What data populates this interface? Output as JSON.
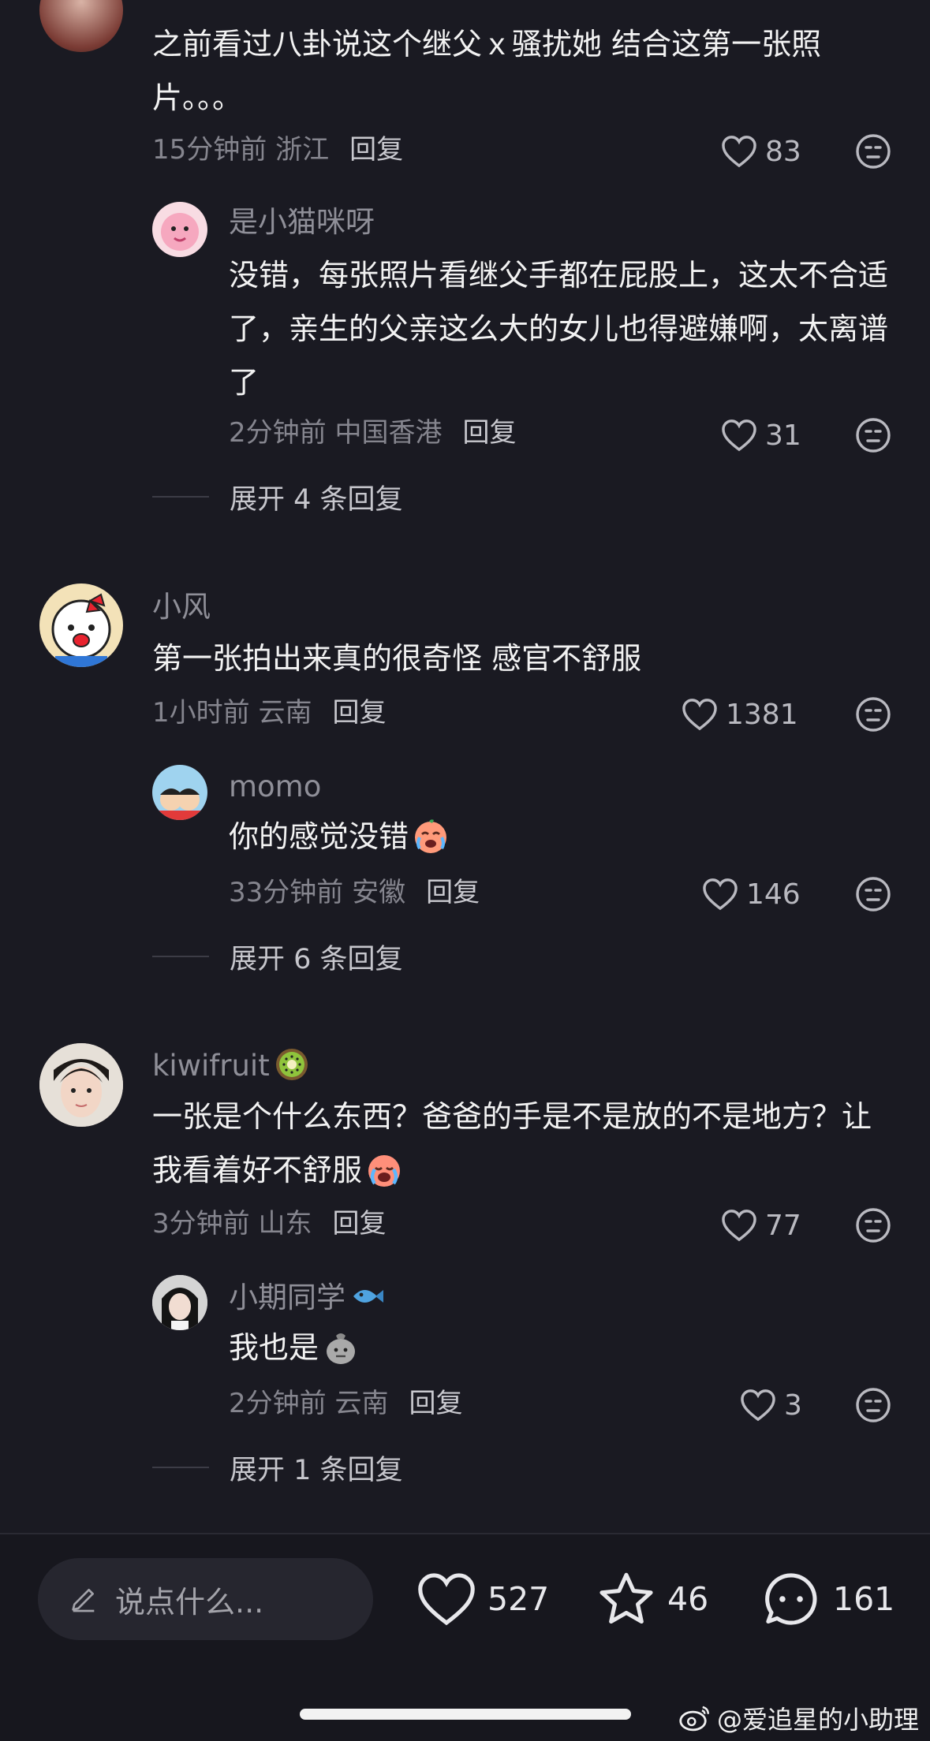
{
  "comments": [
    {
      "text": "之前看过八卦说这个继父ｘ骚扰她 结合这第一张照片。。。",
      "meta": "15分钟前 浙江",
      "reply_label": "回复",
      "likes": "83"
    },
    {
      "name": "是小猫咪呀",
      "text": "没错，每张照片看继父手都在屁股上，这太不合适了，亲生的父亲这么大的女儿也得避嫌啊，太离谱了",
      "meta": "2分钟前 中国香港",
      "reply_label": "回复",
      "likes": "31",
      "expand": "展开 4 条回复"
    },
    {
      "name": "小风",
      "text": "第一张拍出来真的很奇怪 感官不舒服",
      "meta": "1小时前 云南",
      "reply_label": "回复",
      "likes": "1381"
    },
    {
      "name": "momo",
      "text": "你的感觉没错",
      "meta": "33分钟前 安徽",
      "reply_label": "回复",
      "likes": "146",
      "expand": "展开 6 条回复"
    },
    {
      "name": "kiwifruit",
      "text": "一张是个什么东西？爸爸的手是不是放的不是地方？让我看着好不舒服",
      "meta": "3分钟前 山东",
      "reply_label": "回复",
      "likes": "77"
    },
    {
      "name": "小期同学",
      "text": "我也是",
      "meta": "2分钟前 云南",
      "reply_label": "回复",
      "likes": "3",
      "expand": "展开 1 条回复"
    }
  ],
  "bottom_bar": {
    "input_placeholder": "说点什么...",
    "likes": "527",
    "stars": "46",
    "comments": "161"
  },
  "watermark": "@爱追星的小助理",
  "colors": {
    "background": "#1a1a22",
    "secondary_text": "#8f8f98"
  }
}
